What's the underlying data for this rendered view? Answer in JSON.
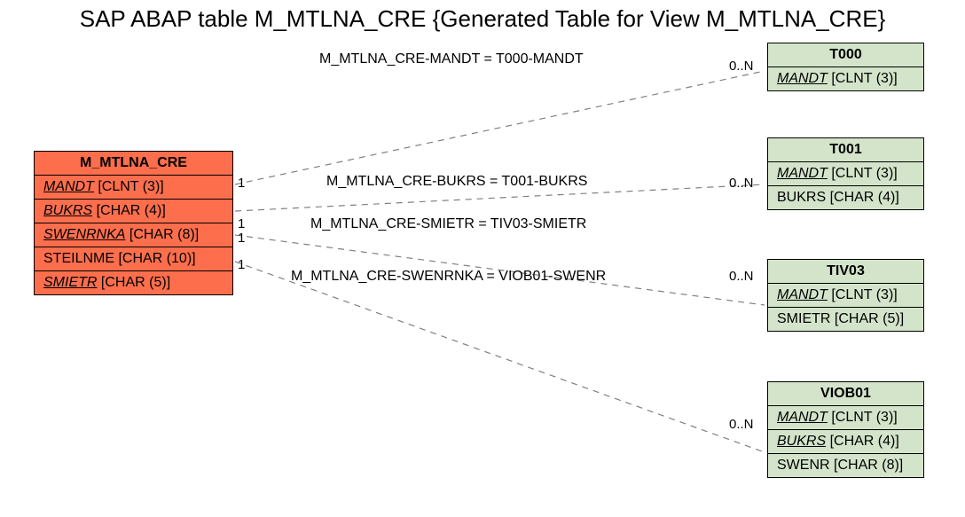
{
  "title": "SAP ABAP table M_MTLNA_CRE {Generated Table for View M_MTLNA_CRE}",
  "mainEntity": {
    "name": "M_MTLNA_CRE",
    "rows": [
      {
        "field": "MANDT",
        "type": "[CLNT (3)]",
        "key": true
      },
      {
        "field": "BUKRS",
        "type": "[CHAR (4)]",
        "key": true
      },
      {
        "field": "SWENRNKA",
        "type": "[CHAR (8)]",
        "key": true
      },
      {
        "field": "STEILNME",
        "type": "[CHAR (10)]",
        "key": false
      },
      {
        "field": "SMIETR",
        "type": "[CHAR (5)]",
        "key": true
      }
    ]
  },
  "relEntities": [
    {
      "name": "T000",
      "rows": [
        {
          "field": "MANDT",
          "type": "[CLNT (3)]",
          "key": true
        }
      ]
    },
    {
      "name": "T001",
      "rows": [
        {
          "field": "MANDT",
          "type": "[CLNT (3)]",
          "key": true
        },
        {
          "field": "BUKRS",
          "type": "[CHAR (4)]",
          "key": false
        }
      ]
    },
    {
      "name": "TIV03",
      "rows": [
        {
          "field": "MANDT",
          "type": "[CLNT (3)]",
          "key": true
        },
        {
          "field": "SMIETR",
          "type": "[CHAR (5)]",
          "key": false
        }
      ]
    },
    {
      "name": "VIOB01",
      "rows": [
        {
          "field": "MANDT",
          "type": "[CLNT (3)]",
          "key": true
        },
        {
          "field": "BUKRS",
          "type": "[CHAR (4)]",
          "key": true
        },
        {
          "field": "SWENR",
          "type": "[CHAR (8)]",
          "key": false
        }
      ]
    }
  ],
  "relations": [
    {
      "label": "M_MTLNA_CRE-MANDT = T000-MANDT",
      "leftCard": "1",
      "rightCard": "0..N"
    },
    {
      "label": "M_MTLNA_CRE-BUKRS = T001-BUKRS",
      "leftCard": "1",
      "rightCard": "0..N"
    },
    {
      "label": "M_MTLNA_CRE-SMIETR = TIV03-SMIETR",
      "leftCard": "1",
      "rightCard": "0..N"
    },
    {
      "label": "M_MTLNA_CRE-SWENRNKA = VIOB01-SWENR",
      "leftCard": "1",
      "rightCard": "0..N"
    }
  ]
}
